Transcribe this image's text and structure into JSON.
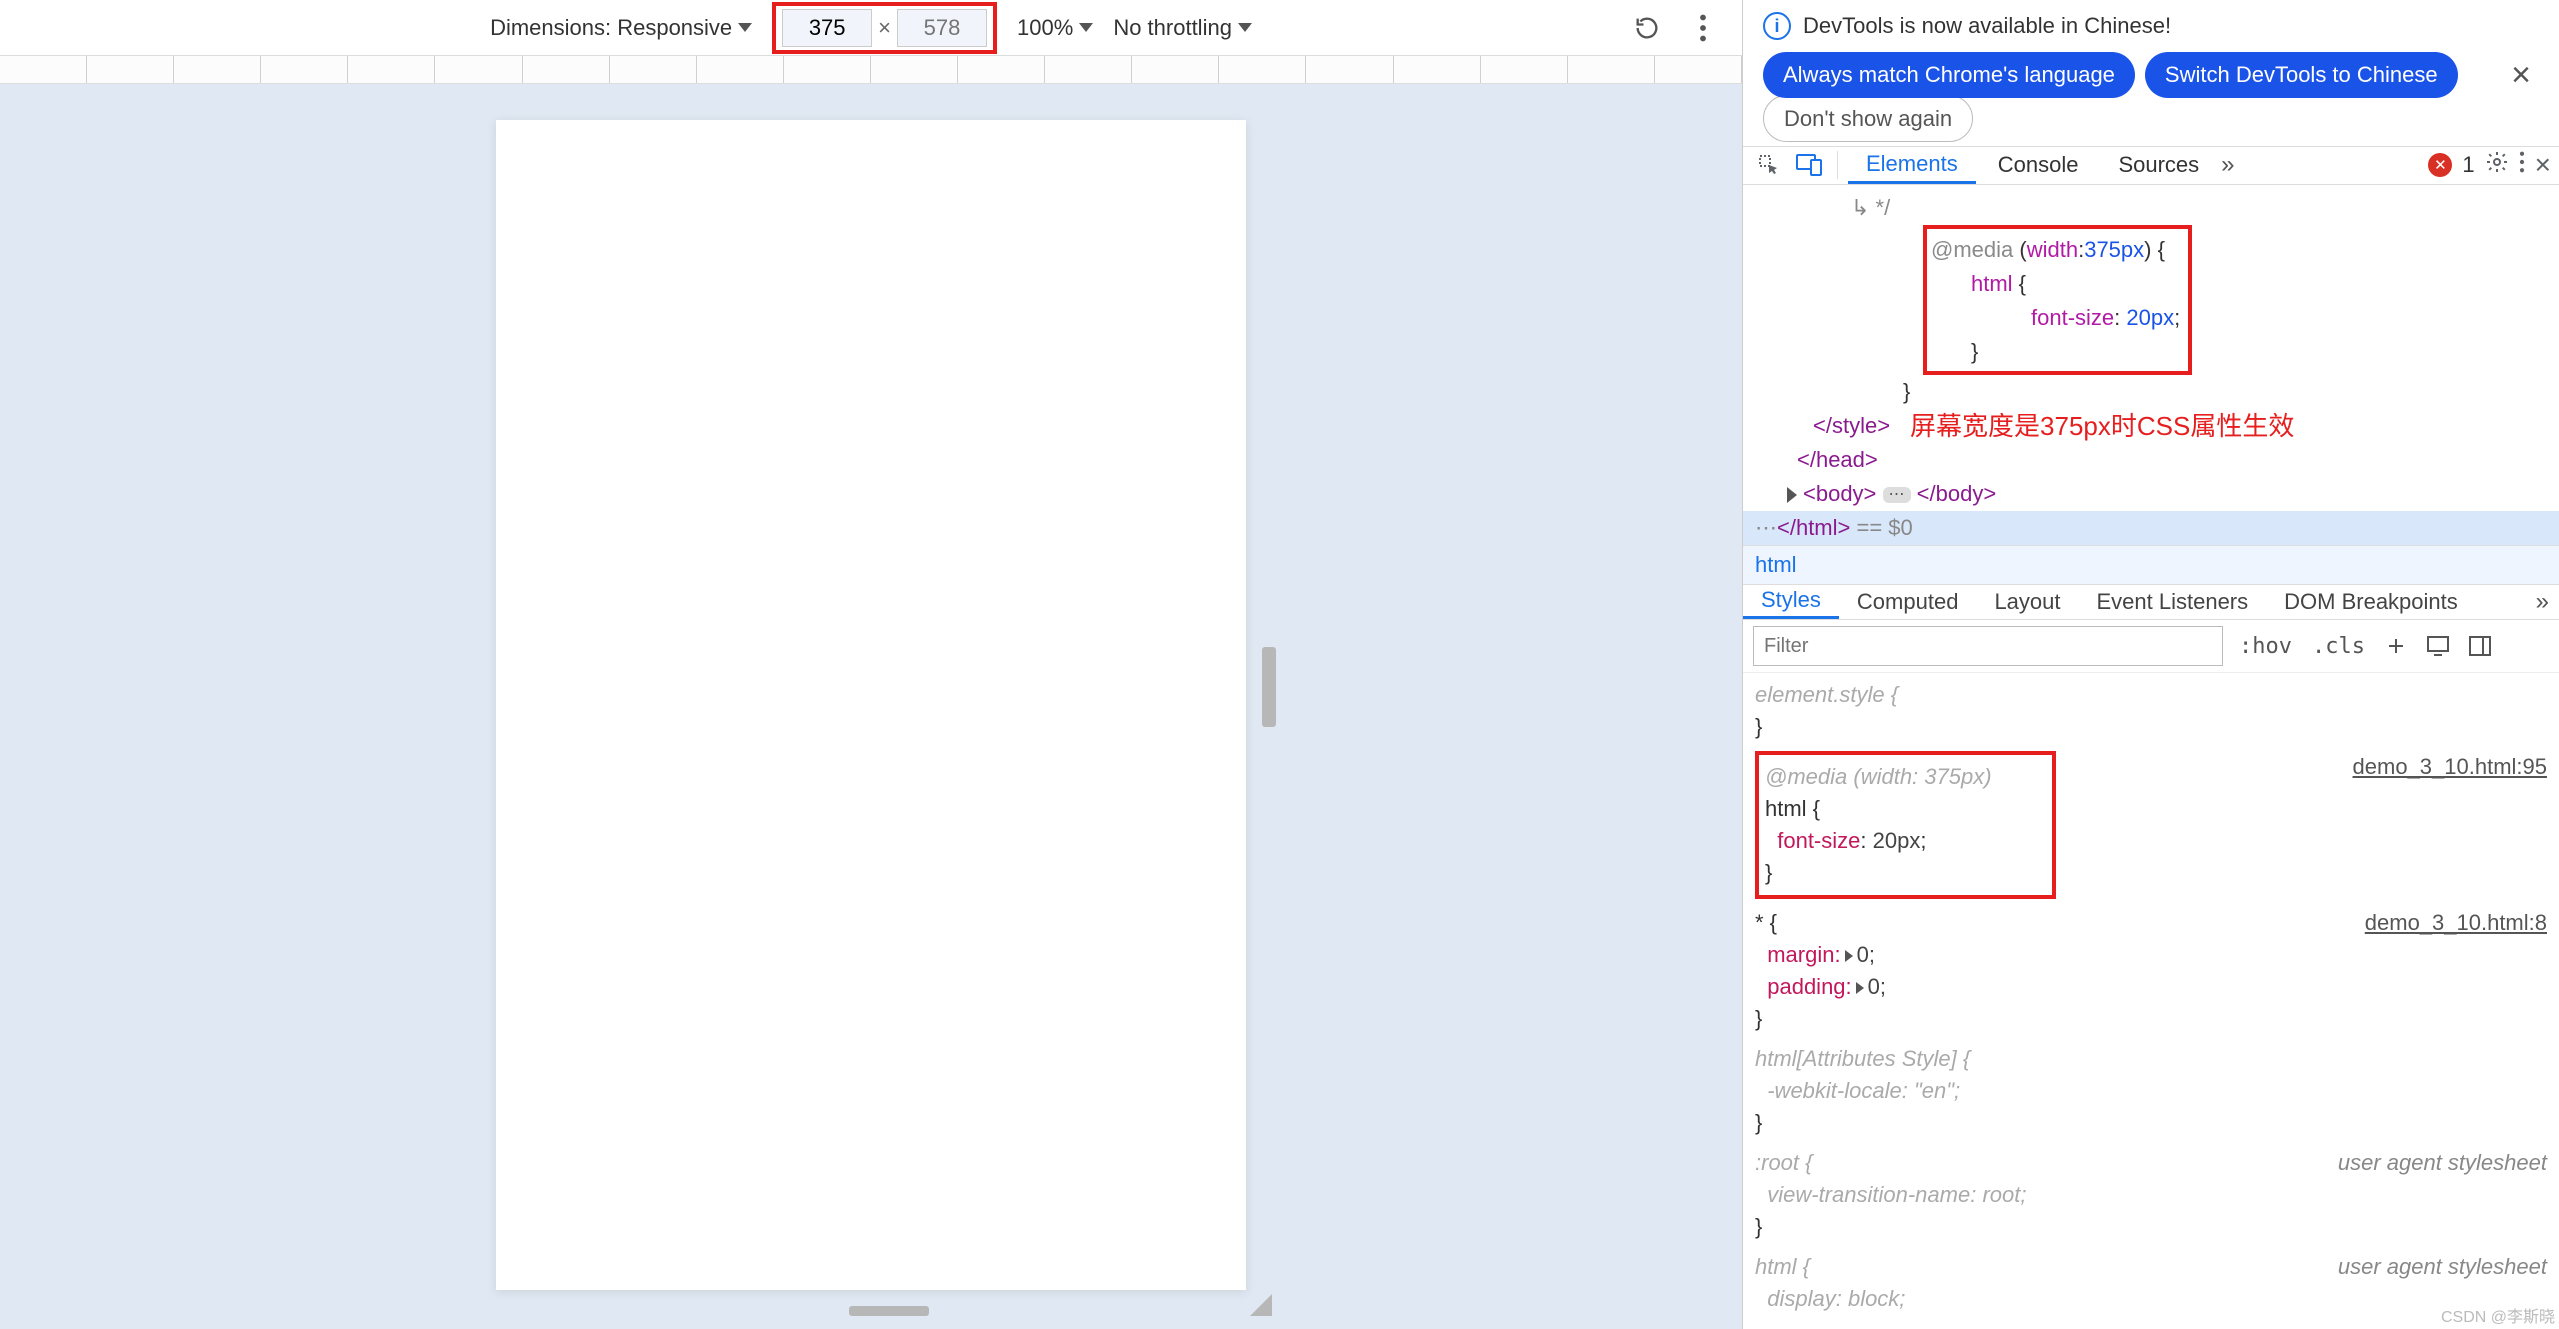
{
  "toolbar": {
    "dimensions_label": "Dimensions: Responsive",
    "width": "375",
    "height_placeholder": "578",
    "zoom": "100%",
    "throttling": "No throttling"
  },
  "info_bar": {
    "message": "DevTools is now available in Chinese!",
    "btn_match": "Always match Chrome's language",
    "btn_switch": "Switch DevTools to Chinese",
    "btn_dont": "Don't show again"
  },
  "dt_tabs": {
    "elements": "Elements",
    "console": "Console",
    "sources": "Sources",
    "error_count": "1"
  },
  "source": {
    "media_line": "@media (width:375px) {",
    "html_open": "html {",
    "font_size": "font-size: 20px;",
    "brace": "}",
    "close_style": "</style>",
    "close_head": "</head>",
    "body_line_open": "<body>",
    "body_line_close": "</body>",
    "close_html": "</html>",
    "eq0": " == $0",
    "annotation": "屏幕宽度是375px时CSS属性生效",
    "top_comment": "*/"
  },
  "breadcrumb": "html",
  "styles_tabs": {
    "styles": "Styles",
    "computed": "Computed",
    "layout": "Layout",
    "events": "Event Listeners",
    "dom": "DOM Breakpoints"
  },
  "styles_toolbar": {
    "filter_placeholder": "Filter",
    "hov": ":hov",
    "cls": ".cls"
  },
  "rules": {
    "element_style": "element.style {",
    "media": "@media (width: 375px)",
    "html_sel": "html {",
    "font_size": "font-size: 20px;",
    "src1": "demo_3_10.html:95",
    "star_sel": "* {",
    "margin": "margin:",
    "margin_v": "0;",
    "padding": "padding:",
    "padding_v": "0;",
    "src2": "demo_3_10.html:8",
    "attr_sel": "html[Attributes Style] {",
    "locale_p": "-webkit-locale:",
    "locale_v": "\"en\";",
    "root_sel": ":root {",
    "vtn_p": "view-transition-name:",
    "vtn_v": "root;",
    "ua": "user agent stylesheet",
    "html2_sel": "html {",
    "display_p": "display:",
    "display_v": "block;"
  },
  "watermark": "CSDN @李斯晓"
}
